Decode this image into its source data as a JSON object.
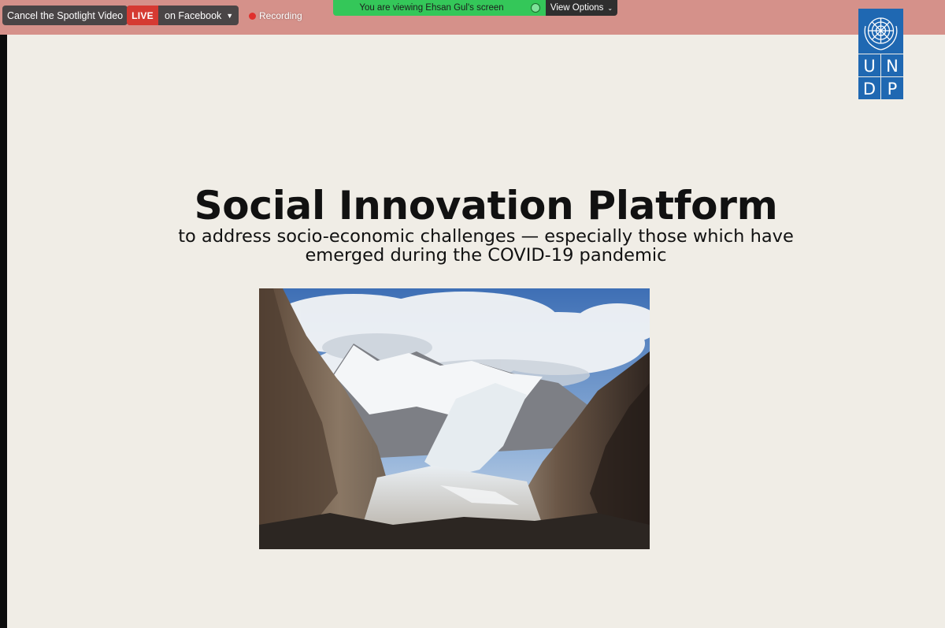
{
  "toolbar": {
    "cancel_spotlight": "Cancel the Spotlight Video",
    "live_badge": "LIVE",
    "live_platform": "on Facebook",
    "recording": "Recording",
    "viewing_message": "You are viewing Ehsan Gul's screen",
    "view_options": "View Options"
  },
  "logo": {
    "letters_top": [
      "U",
      "N"
    ],
    "letters_bottom": [
      "D",
      "P"
    ],
    "color": "#1f68b2"
  },
  "slide": {
    "title": "Social Innovation Platform",
    "subtitle_line1": "to address socio-economic challenges — especially those which have",
    "subtitle_line2": "emerged during the COVID-19 pandemic",
    "image": "glacier-mountain-photo"
  },
  "colors": {
    "top_bar": "#d5918a",
    "slide_background": "#f0ede6",
    "live_red": "#d53a32",
    "viewing_green": "#34c759"
  }
}
